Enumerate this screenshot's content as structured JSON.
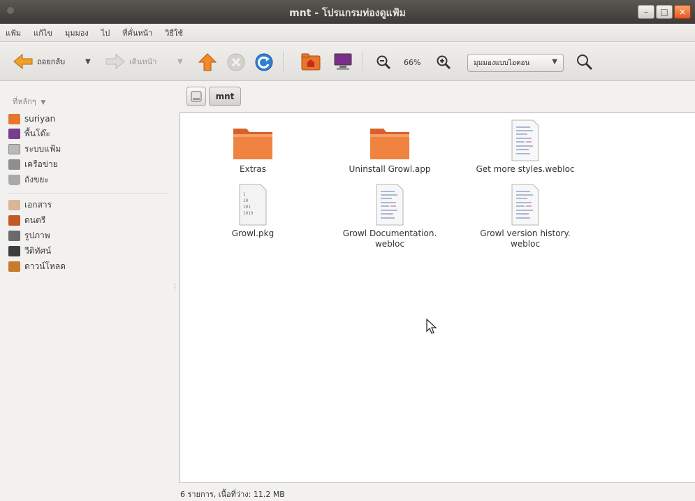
{
  "window": {
    "title": "mnt - โปรแกรมท่องดูแฟ้ม",
    "controls": {
      "minimize": "–",
      "maximize": "□",
      "close": "×"
    }
  },
  "menu": [
    "แฟ้ม",
    "แก้ไข",
    "มุมมอง",
    "ไป",
    "ที่คั่นหน้า",
    "วิธีใช้"
  ],
  "toolbar": {
    "back_label": "ถอยกลับ",
    "forward_label": "เดินหน้า",
    "zoom_level": "66%",
    "view_mode": "มุมมองแบบไอคอน",
    "icons": [
      "back-arrow-icon",
      "forward-arrow-icon",
      "up-arrow-icon",
      "stop-icon",
      "reload-icon",
      "home-folder-icon",
      "computer-icon",
      "zoom-out-icon",
      "zoom-in-icon",
      "search-icon"
    ]
  },
  "sidebar": {
    "header": "ที่หลักๆ",
    "places": [
      {
        "label": "suriyan",
        "icon": "home-icon",
        "color": "#e8762c"
      },
      {
        "label": "พื้นโต๊ะ",
        "icon": "desktop-icon",
        "color": "#7a3c8c"
      },
      {
        "label": "ระบบแฟ้ม",
        "icon": "filesystem-icon",
        "color": "#9b9b9b"
      },
      {
        "label": "เครือข่าย",
        "icon": "network-icon",
        "color": "#7e7e7e"
      },
      {
        "label": "ถังขยะ",
        "icon": "trash-icon",
        "color": "#8d8d8d"
      }
    ],
    "bookmarks": [
      {
        "label": "เอกสาร",
        "icon": "documents-icon",
        "color": "#c9a27a"
      },
      {
        "label": "ดนตรี",
        "icon": "music-icon",
        "color": "#c25a23"
      },
      {
        "label": "รูปภาพ",
        "icon": "pictures-icon",
        "color": "#6a6a6a"
      },
      {
        "label": "วีดิทัศน์",
        "icon": "videos-icon",
        "color": "#3d3d3d"
      },
      {
        "label": "ดาวน์โหลด",
        "icon": "downloads-icon",
        "color": "#c87b2c"
      }
    ]
  },
  "path": {
    "current": "mnt"
  },
  "files": [
    {
      "name": "Extras",
      "type": "folder"
    },
    {
      "name": "Uninstall Growl.app",
      "type": "folder"
    },
    {
      "name": "Get more styles.webloc",
      "type": "webloc"
    },
    {
      "name": "Growl.pkg",
      "type": "binary"
    },
    {
      "name_line1": "Growl Documentation.",
      "name_line2": "webloc",
      "type": "webloc"
    },
    {
      "name_line1": "Growl version history.",
      "name_line2": "webloc",
      "type": "webloc"
    }
  ],
  "status": {
    "text": "6 รายการ, เนื้อที่ว่าง: 11.2 MB"
  },
  "colors": {
    "titlebar": "#3c3b37",
    "accent": "#e8762c",
    "folder": "#ec7a3e"
  }
}
